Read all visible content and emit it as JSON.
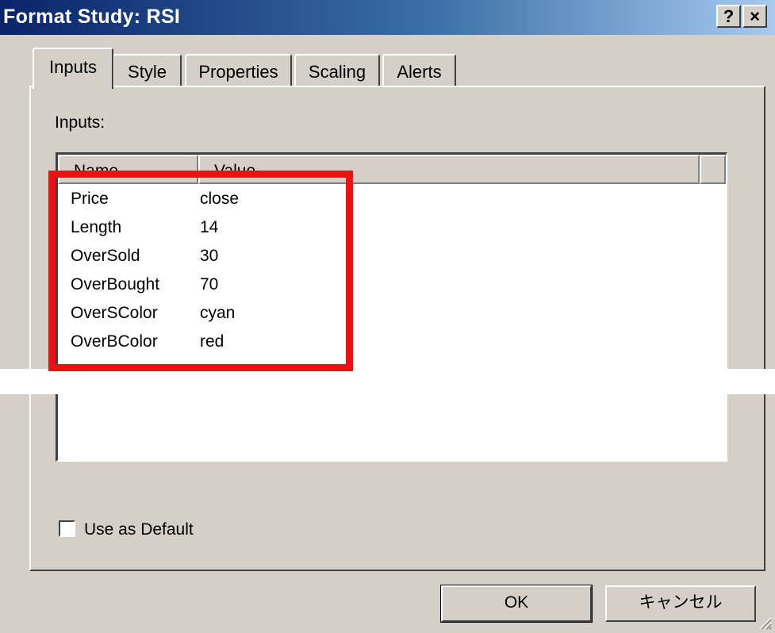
{
  "window": {
    "title": "Format Study: RSI",
    "help_label": "?",
    "close_label": "×"
  },
  "tabs": [
    {
      "label": "Inputs",
      "active": true
    },
    {
      "label": "Style",
      "active": false
    },
    {
      "label": "Properties",
      "active": false
    },
    {
      "label": "Scaling",
      "active": false
    },
    {
      "label": "Alerts",
      "active": false
    }
  ],
  "inputs_section": {
    "label": "Inputs:",
    "columns": [
      "Name",
      "Value"
    ],
    "rows": [
      {
        "name": "Price",
        "value": "close"
      },
      {
        "name": "Length",
        "value": "14"
      },
      {
        "name": "OverSold",
        "value": "30"
      },
      {
        "name": "OverBought",
        "value": "70"
      },
      {
        "name": "OverSColor",
        "value": "cyan"
      },
      {
        "name": "OverBColor",
        "value": "red"
      }
    ]
  },
  "default_checkbox": {
    "label": "Use as Default",
    "checked": false
  },
  "buttons": {
    "ok": "OK",
    "cancel": "キャンセル"
  },
  "colors": {
    "highlight_box": "#ee1111",
    "dialog_face": "#d4d0c8",
    "titlebar_start": "#0a246a",
    "titlebar_end": "#a6caf0"
  }
}
